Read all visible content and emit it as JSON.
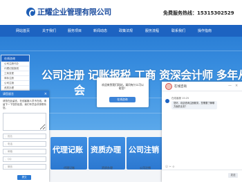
{
  "header": {
    "brand": "正耀企业管理有限公司",
    "hotline": "免费服务热线：15315302529"
  },
  "nav": {
    "items": [
      "网站首页",
      "关于我们",
      "服务项目",
      "新闻动态",
      "政策法规",
      "服务流程",
      "联系我们",
      "操作指南"
    ]
  },
  "banner": {
    "slogan_line1": "公司注册  记账报税  工商  资深会计师  多年从业经验",
    "slogan_line2": "会"
  },
  "sidebar": {
    "title": "在线咨询",
    "items": [
      "公司注册代办",
      "代理记账报税",
      "工商变更",
      "商标注册",
      "公司注销",
      "资质办理"
    ]
  },
  "popup": {
    "text": "欢迎来到我们网站，请问有什么可以帮您？",
    "button": "在线咨询"
  },
  "services": {
    "cards": [
      {
        "big": "代理记账",
        "label": "代理记账"
      },
      {
        "big": "资质办理",
        "label": "资质办理"
      },
      {
        "big": "公司注销",
        "label": "公司注销"
      }
    ]
  },
  "message_form": {
    "title": "请您留言",
    "close": "×",
    "intro": "请您在此留言，在线客服人员不在线，请留下一下您的信息，我们专员会尽快联系您。",
    "textarea_placeholder": "",
    "name_placeholder": "姓名",
    "phone_placeholder": "电话",
    "email_placeholder": "邮箱",
    "qq_placeholder": "QQ",
    "wechat_placeholder": "微信",
    "submit": "提交"
  },
  "chat": {
    "title": "在线咨询",
    "minimize": "—",
    "close": "×",
    "agent_name": "在线客服  15:25",
    "message": "您好，欢迎咨询注册服务，您需要了解哪方面的业务？",
    "tools": "☺  ✂  ⊘",
    "send": "发送"
  }
}
